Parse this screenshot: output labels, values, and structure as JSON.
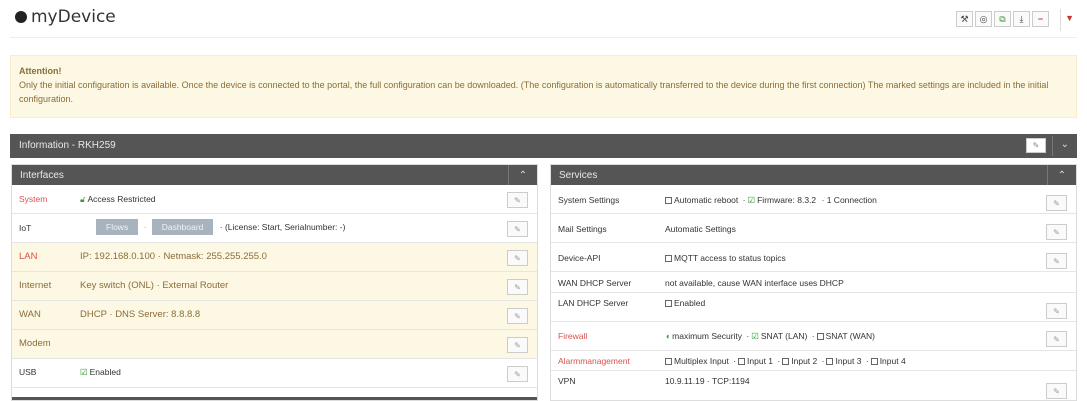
{
  "header": {
    "device_name": "myDevice",
    "tools": [
      {
        "icon": "wrench-icon",
        "glyph": "🔧"
      },
      {
        "icon": "binoculars-icon",
        "glyph": "👁"
      },
      {
        "icon": "copy-icon",
        "glyph": "⧉"
      },
      {
        "icon": "download-icon",
        "glyph": "⭳"
      },
      {
        "icon": "minus-icon",
        "glyph": "−"
      }
    ]
  },
  "alert": {
    "title": "Attention!",
    "text": "Only the initial configuration is available. Once the device is connected to the portal, the full configuration can be downloaded. (The configuration is automatically transferred to the device during the first connection) The marked settings are included in the initial configuration."
  },
  "info": {
    "title": "Information - RKH259"
  },
  "interfaces": {
    "title": "Interfaces",
    "system": {
      "label": "System",
      "value": "Access Restricted"
    },
    "iot": {
      "label": "IoT",
      "flows": "Flows",
      "dashboard": "Dashboard",
      "license": "· (License: Start, Serialnumber: -)"
    },
    "lan": {
      "label": "LAN",
      "value": "IP: 192.168.0.100  · Netmask: 255.255.255.0"
    },
    "internet": {
      "label": "Internet",
      "value": "Key switch (ONL)  · External Router"
    },
    "wan": {
      "label": "WAN",
      "value": "DHCP  · DNS Server: 8.8.8.8"
    },
    "modem": {
      "label": "Modem"
    },
    "usb": {
      "label": "USB",
      "value": "Enabled"
    }
  },
  "services": {
    "title": "Services",
    "system_settings": {
      "label": "System Settings",
      "reboot": "Automatic reboot",
      "firmware": "Firmware: 8.3.2",
      "connections": "· 1 Connection"
    },
    "mail": {
      "label": "Mail Settings",
      "value": "Automatic Settings"
    },
    "device_api": {
      "label": "Device-API",
      "value": "MQTT access to status topics"
    },
    "wan_dhcp": {
      "label": "WAN DHCP Server",
      "value": "not available, cause WAN interface uses DHCP"
    },
    "lan_dhcp": {
      "label": "LAN DHCP Server",
      "value": "Enabled"
    },
    "firewall": {
      "label": "Firewall",
      "security": "maximum Security",
      "snat_lan": "SNAT (LAN)",
      "snat_wan": "SNAT (WAN)"
    },
    "alarm": {
      "label": "Alarmmanagement",
      "multiplex": "Multiplex Input",
      "input1": "Input 1",
      "input2": "Input 2",
      "input3": "Input 3",
      "input4": "Input 4"
    },
    "vpn": {
      "label": "VPN",
      "value": "10.9.11.19  · TCP:1194"
    }
  },
  "colors": {
    "accent_red": "#d9534f",
    "highlight_bg": "#fcf8e3",
    "panel_head": "#555555",
    "check_green": "#3a9b3a"
  }
}
